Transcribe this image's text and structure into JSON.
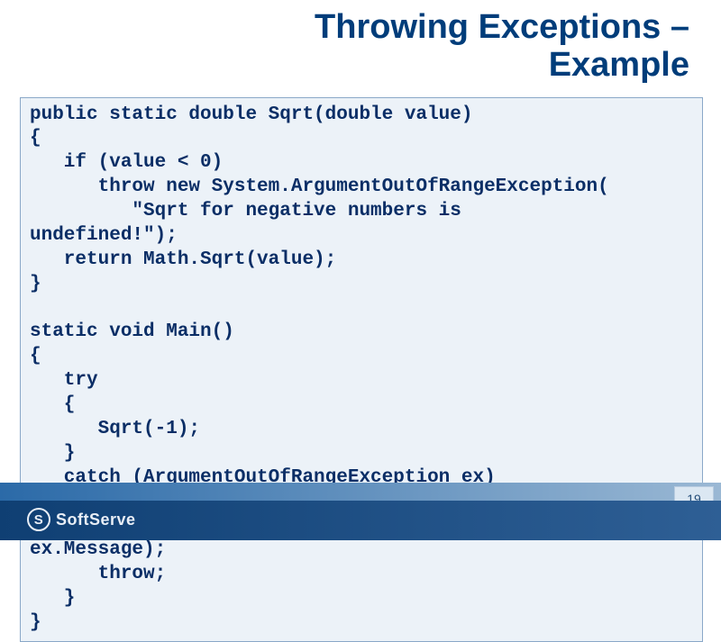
{
  "title_line1": "Throwing Exceptions –",
  "title_line2": "Example",
  "code": "public static double Sqrt(double value)\n{\n   if (value < 0)\n      throw new System.ArgumentOutOfRangeException(\n         \"Sqrt for negative numbers is\nundefined!\");\n   return Math.Sqrt(value);\n}\n\nstatic void Main()\n{\n   try\n   {\n      Sqrt(-1);\n   }\n   catch (ArgumentOutOfRangeException ex)\n   {\n      Console.Error.WriteLine(\"Error: \" +\nex.Message);\n      throw;\n   }\n}",
  "brand": "SoftServe",
  "page_number": "19"
}
